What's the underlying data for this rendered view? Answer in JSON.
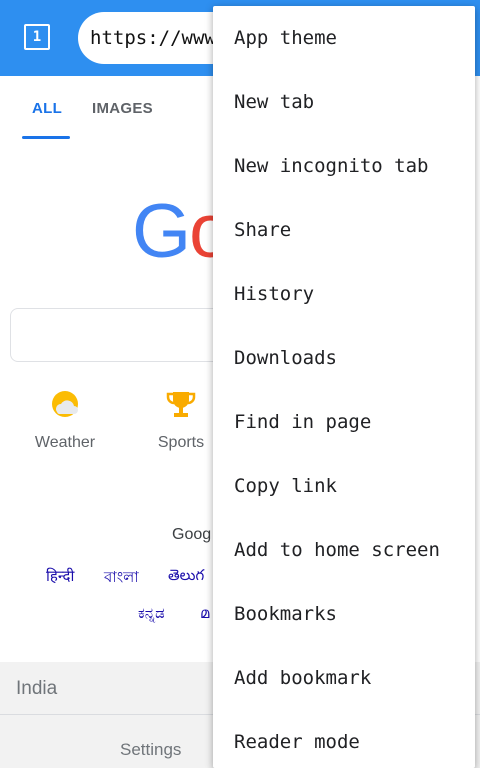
{
  "toolbar": {
    "tab_count": "1",
    "url": "https://www"
  },
  "search_tabs": {
    "all": "ALL",
    "images": "IMAGES"
  },
  "logo": {
    "visible_part_1": "G",
    "visible_part_2": "o"
  },
  "shortcuts": [
    {
      "label": "Weather",
      "icon": "weather-icon"
    },
    {
      "label": "Sports",
      "icon": "trophy-icon"
    }
  ],
  "offered_in": "Goog",
  "languages": {
    "row1": [
      "हिन्दी",
      "বাংলা",
      "తెలుగ"
    ],
    "row2": [
      "ಕನ್ನಡ",
      "മ"
    ]
  },
  "footer": {
    "country": "India",
    "settings": "Settings"
  },
  "menu": {
    "items": [
      "App theme",
      "New tab",
      "New incognito tab",
      "Share",
      "History",
      "Downloads",
      "Find in page",
      "Copy link",
      "Add to home screen",
      "Bookmarks",
      "Add bookmark",
      "Reader mode"
    ]
  },
  "colors": {
    "toolbar": "#2e8ff0",
    "link": "#1a0dab",
    "google_blue": "#4285f4",
    "google_red": "#ea4335"
  }
}
